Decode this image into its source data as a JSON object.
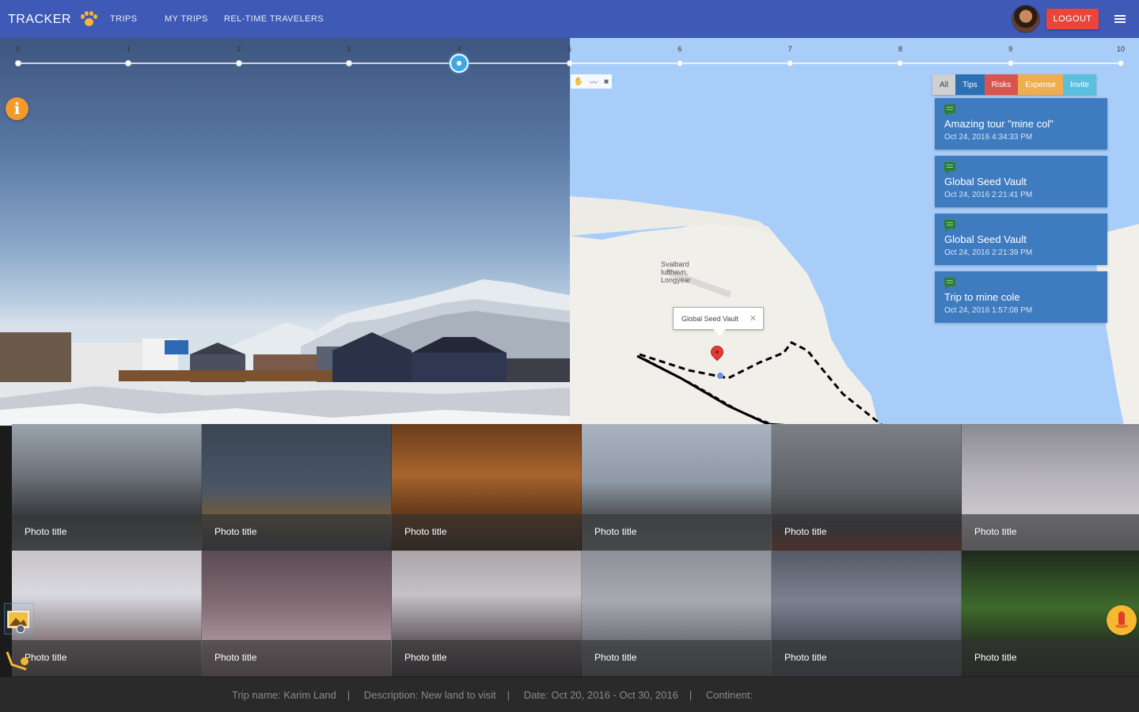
{
  "header": {
    "brand": "TRACKER",
    "nav": [
      "TRIPS",
      "MY TRIPS",
      "REL-TIME TRAVELERS"
    ],
    "logout_label": "LOGOUT"
  },
  "timeline": {
    "labels": [
      "0",
      "1",
      "2",
      "3",
      "4",
      "5",
      "6",
      "7",
      "8",
      "9",
      "10"
    ],
    "active_index": 4
  },
  "filters": [
    {
      "label": "All",
      "color": "#d0d0d0",
      "text": "#444444"
    },
    {
      "label": "Tips",
      "color": "#2b6fb5",
      "text": "#ffffff"
    },
    {
      "label": "Risks",
      "color": "#d9534f",
      "text": "#ffffff"
    },
    {
      "label": "Expense",
      "color": "#f0ad4e",
      "text": "#ffffff"
    },
    {
      "label": "Invite",
      "color": "#5bc0de",
      "text": "#ffffff"
    }
  ],
  "events": [
    {
      "title": "Amazing tour \"mine col\"",
      "time": "Oct 24, 2016 4:34:33 PM"
    },
    {
      "title": "Global Seed Vault",
      "time": "Oct 24, 2016 2:21:41 PM"
    },
    {
      "title": "Global Seed Vault",
      "time": "Oct 24, 2016 2:21:39 PM"
    },
    {
      "title": "Trip to mine cole",
      "time": "Oct 24, 2016 1:57:08 PM"
    }
  ],
  "map": {
    "popup": "Global Seed Vault",
    "place_label": "Svalbard\nlufthavn,\nLongyear"
  },
  "photos": [
    {
      "title": "Photo title",
      "bg": "linear-gradient(180deg,#9aa3ad 0%,#6d737a 40%,#3c3f44 70%,#5d6067 100%)"
    },
    {
      "title": "Photo title",
      "bg": "linear-gradient(180deg,#3a4554 0%,#4a5666 50%,#6b5a45 70%,#2f3640 100%)"
    },
    {
      "title": "Photo title",
      "bg": "linear-gradient(180deg,#6b3b1d 0%,#a8642c 40%,#5a3418 75%,#2a1a0f 100%)"
    },
    {
      "title": "Photo title",
      "bg": "linear-gradient(180deg,#aab4bf 0%,#8f9aa6 45%,#55585c 70%,#6f7278 100%)"
    },
    {
      "title": "Photo title",
      "bg": "linear-gradient(180deg,#7c8086 0%,#5e6166 50%,#3a3b3f 80%,#7a2e22 100%)"
    },
    {
      "title": "Photo title",
      "bg": "linear-gradient(180deg,#8a8a92 0%,#b4b2b8 40%,#c9c7cc 70%,#9a99a0 100%)"
    },
    {
      "title": "Photo title",
      "bg": "linear-gradient(180deg,#c8c3c6 0%,#d8d9e0 35%,#8c7f83 70%,#4d4449 100%)"
    },
    {
      "title": "Photo title",
      "bg": "linear-gradient(180deg,#5a4b52 0%,#7f6a72 40%,#a58d95 70%,#6c5c63 100%)"
    },
    {
      "title": "Photo title",
      "bg": "linear-gradient(180deg,#a9a4a8 0%,#c5c2c6 35%,#6b6368 70%,#2e2a2e 100%)"
    },
    {
      "title": "Photo title",
      "bg": "linear-gradient(180deg,#8d9097 0%,#a7aab0 40%,#6a6e74 75%,#4a4d52 100%)"
    },
    {
      "title": "Photo title",
      "bg": "linear-gradient(180deg,#555a66 0%,#7c8190 40%,#4f5460 70%,#3b3f47 100%)"
    },
    {
      "title": "Photo title",
      "bg": "linear-gradient(180deg,#1f2a1c 0%,#3e6a2c 45%,#2a3b22 70%,#151c14 100%)"
    }
  ],
  "footer": {
    "trip_name": "Trip name: Karim Land",
    "description": "Description: New land to visit",
    "date": "Date: Oct 20, 2016 - Oct 30, 2016",
    "continent": "Continent:"
  }
}
